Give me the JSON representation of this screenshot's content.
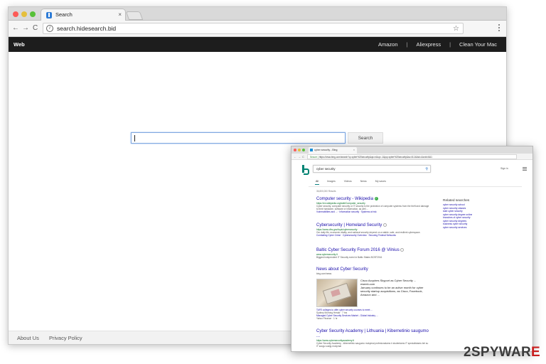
{
  "browser": {
    "tab_title": "Search",
    "tab_close": "×",
    "url": "search.hidesearch.bid",
    "nav_back": "←",
    "nav_forward": "→",
    "nav_reload": "C",
    "info_icon": "i",
    "bookmark_star": "☆"
  },
  "topnav": {
    "brand": "Web",
    "links": [
      "Amazon",
      "Aliexpress",
      "Clean Your Mac"
    ],
    "separator": "|"
  },
  "search": {
    "input_value": "",
    "button_label": "Search"
  },
  "footer": {
    "about": "About Us",
    "privacy": "Privacy Policy"
  },
  "inset": {
    "tab_title": "cyber security - Bing",
    "tab_close": "×",
    "url_secure": "Secure",
    "url_rest": "https://www.bing.com/search?q=cyber%20security&qs=n&sp=-1&pq=cyber%20security&sc=8-14&sk=&cvid=6A1",
    "query": "cyber security",
    "sign_in": "Sign in",
    "tabs": [
      "All",
      "Images",
      "Videos",
      "News",
      "My saves"
    ],
    "results_count": "36,800,000 Results",
    "results": [
      {
        "title": "Computer security - Wikipedia",
        "url": "https://en.wikipedia.org/wiki/Computer_security",
        "snippet": "Cyber security, computer security or IT security is the protection of computer systems from the theft and damage to their hardware, software or information, as well ...",
        "links": "Vulnerabilities and ... · Information security · Systems at risk"
      },
      {
        "title": "Cybersecurity | Homeland Security",
        "url": "https://www.dhs.gov/topic/cybersecurity",
        "snippet": "Our daily life, economic vitality, and national security depend on a stable, safe, and resilient cyberspace.",
        "links": "Combating Cyber Crime · Cybersecurity Overview · Securing Federal Networks"
      },
      {
        "title": "Baltic Cyber Security Forum 2016 @ Vilnius",
        "url": "www.cybersecurity.lt",
        "snippet": "Biggest independent IT Security event in Baltic States BCSF2016",
        "links": ""
      }
    ],
    "news": {
      "title": "News about Cyber Security",
      "source_line": "bing.com/news",
      "item_title": "Cisco Acquires Skyport as Cyber Security ...",
      "item_source": "eweek.com",
      "item_snippet": "January continues to be an active month for cyber security startup acquisitions, as Cisco, Facebook, Amazon and ...",
      "extra1": "TAFE colleges to offer cyber security courses to meet ...",
      "extra1_src": "Sydney Morning Herald · 7 hrs",
      "extra2": "Managed Cyber Security Services Market - Global Industry ...",
      "extra2_src": "Yahoo Finance · 1 hr"
    },
    "last_result": {
      "title": "Cyber Security Academy | Lithuania | Kibernetinio saugumo ...",
      "url": "https://www.cybersecurityacademy.lt",
      "snippet": "Cyber Security Academy - kibernetinio saugumo mokymai profesionalams ir studentams IT specialistams bei su IT saugu susiję mokymai"
    },
    "related_heading": "Related searches",
    "related": [
      "cyber security school",
      "cyber security classes",
      "start cyber security",
      "cyber security degree online",
      "branches of cyber security",
      "cyber security degrees",
      "business cyber security",
      "cyber security services"
    ]
  },
  "watermark": {
    "part1": "2SPYWAR",
    "part2": "E"
  }
}
